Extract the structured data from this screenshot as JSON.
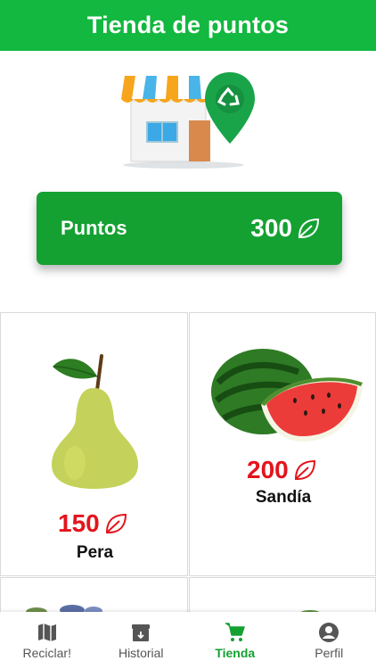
{
  "header": {
    "title": "Tienda de puntos"
  },
  "points": {
    "label": "Puntos",
    "value": "300"
  },
  "products": [
    {
      "name": "Pera",
      "price": "150"
    },
    {
      "name": "Sandía",
      "price": "200"
    }
  ],
  "nav": [
    {
      "label": "Reciclar!",
      "icon": "map-icon",
      "active": false
    },
    {
      "label": "Historial",
      "icon": "archive-icon",
      "active": false
    },
    {
      "label": "Tienda",
      "icon": "cart-icon",
      "active": true
    },
    {
      "label": "Perfil",
      "icon": "account-icon",
      "active": false
    }
  ],
  "colors": {
    "primary": "#12b83f",
    "card": "#14a132",
    "price": "#e3141c"
  }
}
